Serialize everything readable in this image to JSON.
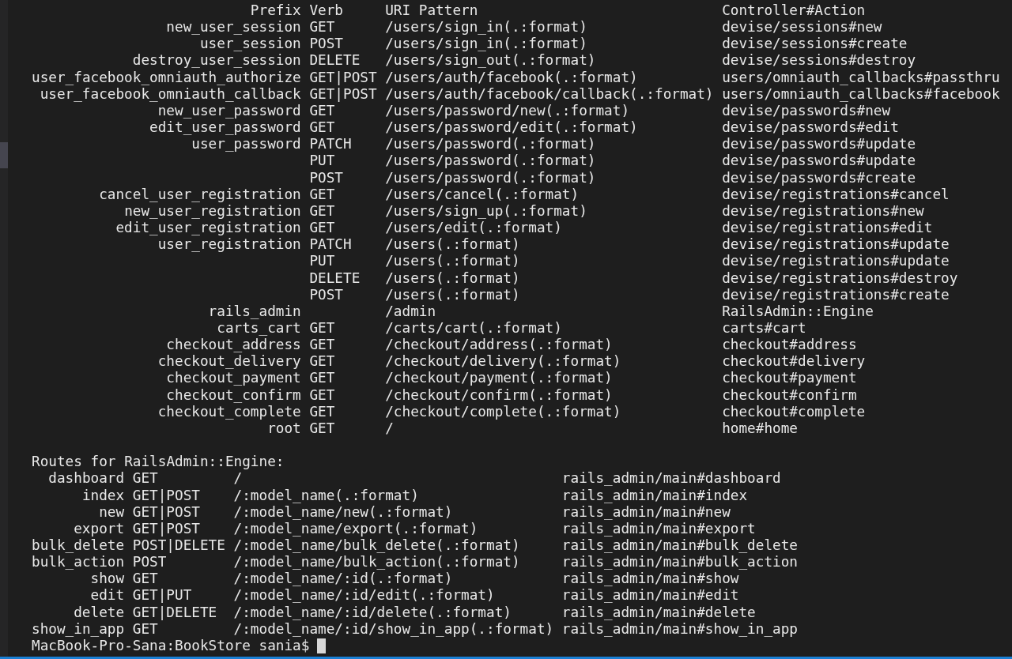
{
  "routes": {
    "columns": [
      "Prefix",
      "Verb",
      "URI Pattern",
      "Controller#Action"
    ],
    "rows": [
      {
        "prefix": "new_user_session",
        "verb": "GET",
        "uri": "/users/sign_in(.:format)",
        "action": "devise/sessions#new"
      },
      {
        "prefix": "user_session",
        "verb": "POST",
        "uri": "/users/sign_in(.:format)",
        "action": "devise/sessions#create"
      },
      {
        "prefix": "destroy_user_session",
        "verb": "DELETE",
        "uri": "/users/sign_out(.:format)",
        "action": "devise/sessions#destroy"
      },
      {
        "prefix": "user_facebook_omniauth_authorize",
        "verb": "GET|POST",
        "uri": "/users/auth/facebook(.:format)",
        "action": "users/omniauth_callbacks#passthru"
      },
      {
        "prefix": "user_facebook_omniauth_callback",
        "verb": "GET|POST",
        "uri": "/users/auth/facebook/callback(.:format)",
        "action": "users/omniauth_callbacks#facebook"
      },
      {
        "prefix": "new_user_password",
        "verb": "GET",
        "uri": "/users/password/new(.:format)",
        "action": "devise/passwords#new"
      },
      {
        "prefix": "edit_user_password",
        "verb": "GET",
        "uri": "/users/password/edit(.:format)",
        "action": "devise/passwords#edit"
      },
      {
        "prefix": "user_password",
        "verb": "PATCH",
        "uri": "/users/password(.:format)",
        "action": "devise/passwords#update"
      },
      {
        "verb": "PUT",
        "uri": "/users/password(.:format)",
        "action": "devise/passwords#update"
      },
      {
        "verb": "POST",
        "uri": "/users/password(.:format)",
        "action": "devise/passwords#create"
      },
      {
        "prefix": "cancel_user_registration",
        "verb": "GET",
        "uri": "/users/cancel(.:format)",
        "action": "devise/registrations#cancel"
      },
      {
        "prefix": "new_user_registration",
        "verb": "GET",
        "uri": "/users/sign_up(.:format)",
        "action": "devise/registrations#new"
      },
      {
        "prefix": "edit_user_registration",
        "verb": "GET",
        "uri": "/users/edit(.:format)",
        "action": "devise/registrations#edit"
      },
      {
        "prefix": "user_registration",
        "verb": "PATCH",
        "uri": "/users(.:format)",
        "action": "devise/registrations#update"
      },
      {
        "verb": "PUT",
        "uri": "/users(.:format)",
        "action": "devise/registrations#update"
      },
      {
        "verb": "DELETE",
        "uri": "/users(.:format)",
        "action": "devise/registrations#destroy"
      },
      {
        "verb": "POST",
        "uri": "/users(.:format)",
        "action": "devise/registrations#create"
      },
      {
        "prefix": "rails_admin",
        "uri": "/admin",
        "action": "RailsAdmin::Engine"
      },
      {
        "prefix": "carts_cart",
        "verb": "GET",
        "uri": "/carts/cart(.:format)",
        "action": "carts#cart"
      },
      {
        "prefix": "checkout_address",
        "verb": "GET",
        "uri": "/checkout/address(.:format)",
        "action": "checkout#address"
      },
      {
        "prefix": "checkout_delivery",
        "verb": "GET",
        "uri": "/checkout/delivery(.:format)",
        "action": "checkout#delivery"
      },
      {
        "prefix": "checkout_payment",
        "verb": "GET",
        "uri": "/checkout/payment(.:format)",
        "action": "checkout#payment"
      },
      {
        "prefix": "checkout_confirm",
        "verb": "GET",
        "uri": "/checkout/confirm(.:format)",
        "action": "checkout#confirm"
      },
      {
        "prefix": "checkout_complete",
        "verb": "GET",
        "uri": "/checkout/complete(.:format)",
        "action": "checkout#complete"
      },
      {
        "prefix": "root",
        "verb": "GET",
        "uri": "/",
        "action": "home#home"
      }
    ]
  },
  "engine_routes": {
    "title": "Routes for RailsAdmin::Engine:",
    "rows": [
      {
        "prefix": "dashboard",
        "verb": "GET",
        "uri": "/",
        "action": "rails_admin/main#dashboard"
      },
      {
        "prefix": "index",
        "verb": "GET|POST",
        "uri": "/:model_name(.:format)",
        "action": "rails_admin/main#index"
      },
      {
        "prefix": "new",
        "verb": "GET|POST",
        "uri": "/:model_name/new(.:format)",
        "action": "rails_admin/main#new"
      },
      {
        "prefix": "export",
        "verb": "GET|POST",
        "uri": "/:model_name/export(.:format)",
        "action": "rails_admin/main#export"
      },
      {
        "prefix": "bulk_delete",
        "verb": "POST|DELETE",
        "uri": "/:model_name/bulk_delete(.:format)",
        "action": "rails_admin/main#bulk_delete"
      },
      {
        "prefix": "bulk_action",
        "verb": "POST",
        "uri": "/:model_name/bulk_action(.:format)",
        "action": "rails_admin/main#bulk_action"
      },
      {
        "prefix": "show",
        "verb": "GET",
        "uri": "/:model_name/:id(.:format)",
        "action": "rails_admin/main#show"
      },
      {
        "prefix": "edit",
        "verb": "GET|PUT",
        "uri": "/:model_name/:id/edit(.:format)",
        "action": "rails_admin/main#edit"
      },
      {
        "prefix": "delete",
        "verb": "GET|DELETE",
        "uri": "/:model_name/:id/delete(.:format)",
        "action": "rails_admin/main#delete"
      },
      {
        "prefix": "show_in_app",
        "verb": "GET",
        "uri": "/:model_name/:id/show_in_app(.:format)",
        "action": "rails_admin/main#show_in_app"
      }
    ]
  },
  "prompt": "MacBook-Pro-Sana:BookStore sania$"
}
